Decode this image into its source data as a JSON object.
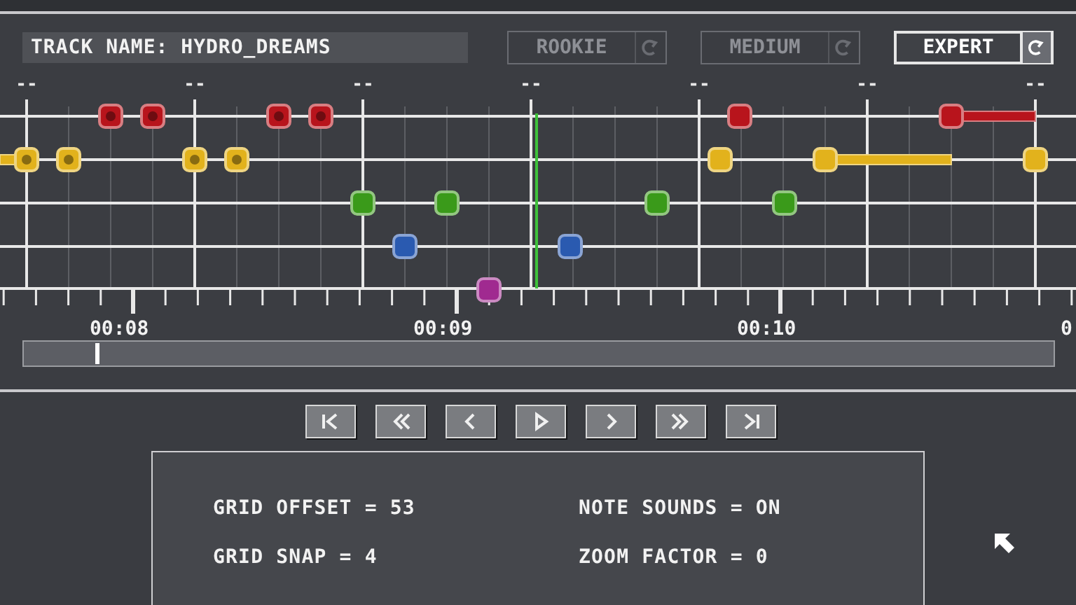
{
  "track_name": "TRACK NAME: HYDRO_DREAMS",
  "difficulties": [
    {
      "label": "ROOKIE",
      "selected": false
    },
    {
      "label": "MEDIUM",
      "selected": false
    },
    {
      "label": "EXPERT",
      "selected": true
    }
  ],
  "measure_labels": [
    "--",
    "--",
    "--",
    "--",
    "--",
    "--",
    "--"
  ],
  "lanes": [
    {
      "color": "#b8141c"
    },
    {
      "color": "#e2b21c"
    },
    {
      "color": "#3a9a1a"
    },
    {
      "color": "#2a5ab0"
    },
    {
      "color": "#a02a90"
    }
  ],
  "time_labels": [
    "00:08",
    "00:09",
    "00:10",
    "0"
  ],
  "transport": [
    {
      "kind": "first"
    },
    {
      "kind": "rewind"
    },
    {
      "kind": "back"
    },
    {
      "kind": "play"
    },
    {
      "kind": "forward"
    },
    {
      "kind": "fast-forward"
    },
    {
      "kind": "last"
    }
  ],
  "settings": [
    "GRID OFFSET = 53",
    "NOTE SOUNDS = ON",
    "GRID SNAP = 4",
    "ZOOM FACTOR = 0"
  ]
}
